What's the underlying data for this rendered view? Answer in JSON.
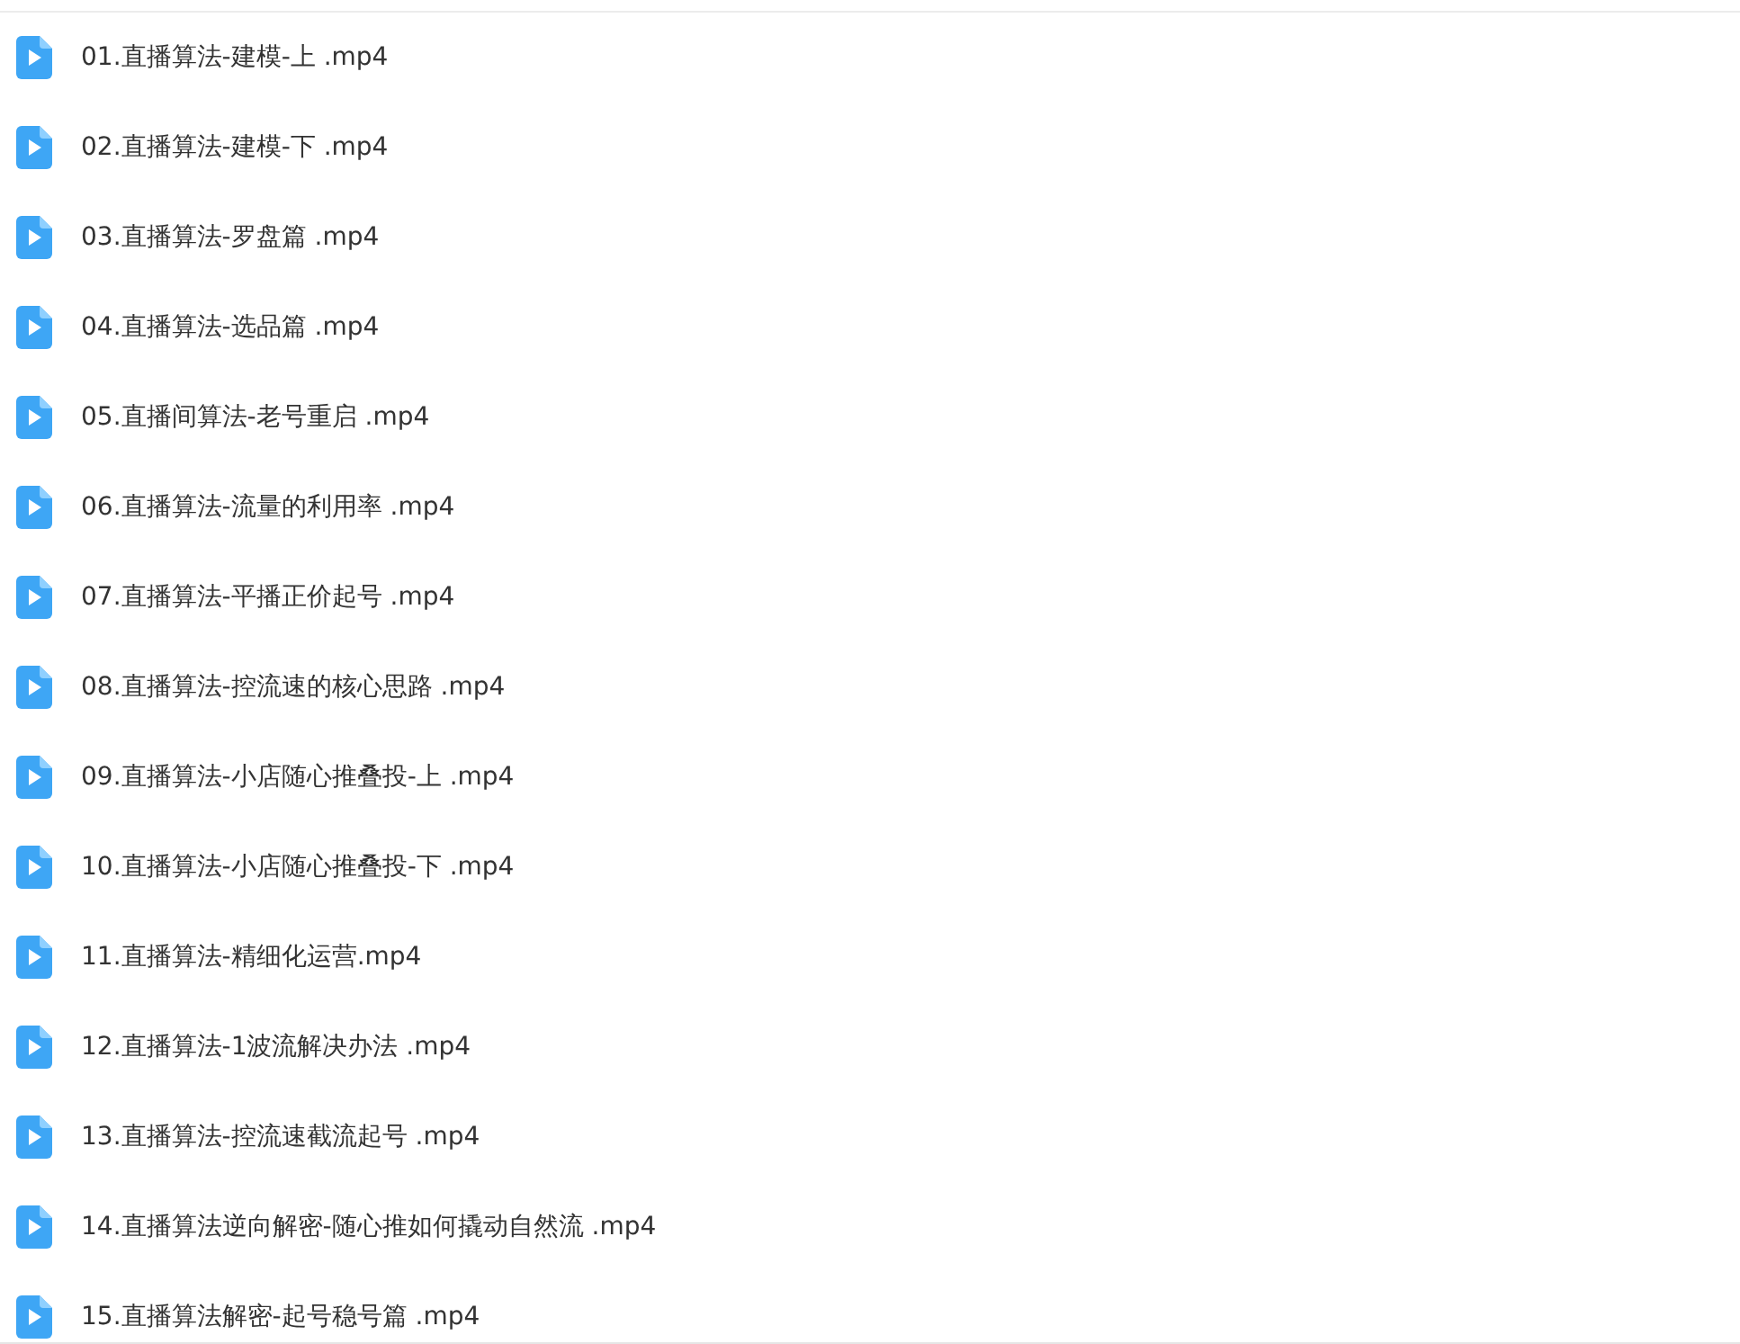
{
  "files": [
    {
      "name": "01.直播算法-建模-上 .mp4"
    },
    {
      "name": "02.直播算法-建模-下 .mp4"
    },
    {
      "name": "03.直播算法-罗盘篇 .mp4"
    },
    {
      "name": "04.直播算法-选品篇 .mp4"
    },
    {
      "name": "05.直播间算法-老号重启 .mp4"
    },
    {
      "name": "06.直播算法-流量的利用率 .mp4"
    },
    {
      "name": "07.直播算法-平播正价起号 .mp4"
    },
    {
      "name": "08.直播算法-控流速的核心思路 .mp4"
    },
    {
      "name": "09.直播算法-小店随心推叠投-上 .mp4"
    },
    {
      "name": "10.直播算法-小店随心推叠投-下 .mp4"
    },
    {
      "name": "11.直播算法-精细化运营.mp4"
    },
    {
      "name": "12.直播算法-1波流解决办法 .mp4"
    },
    {
      "name": "13.直播算法-控流速截流起号 .mp4"
    },
    {
      "name": "14.直播算法逆向解密-随心推如何撬动自然流 .mp4"
    },
    {
      "name": "15.直播算法解密-起号稳号篇 .mp4"
    }
  ]
}
